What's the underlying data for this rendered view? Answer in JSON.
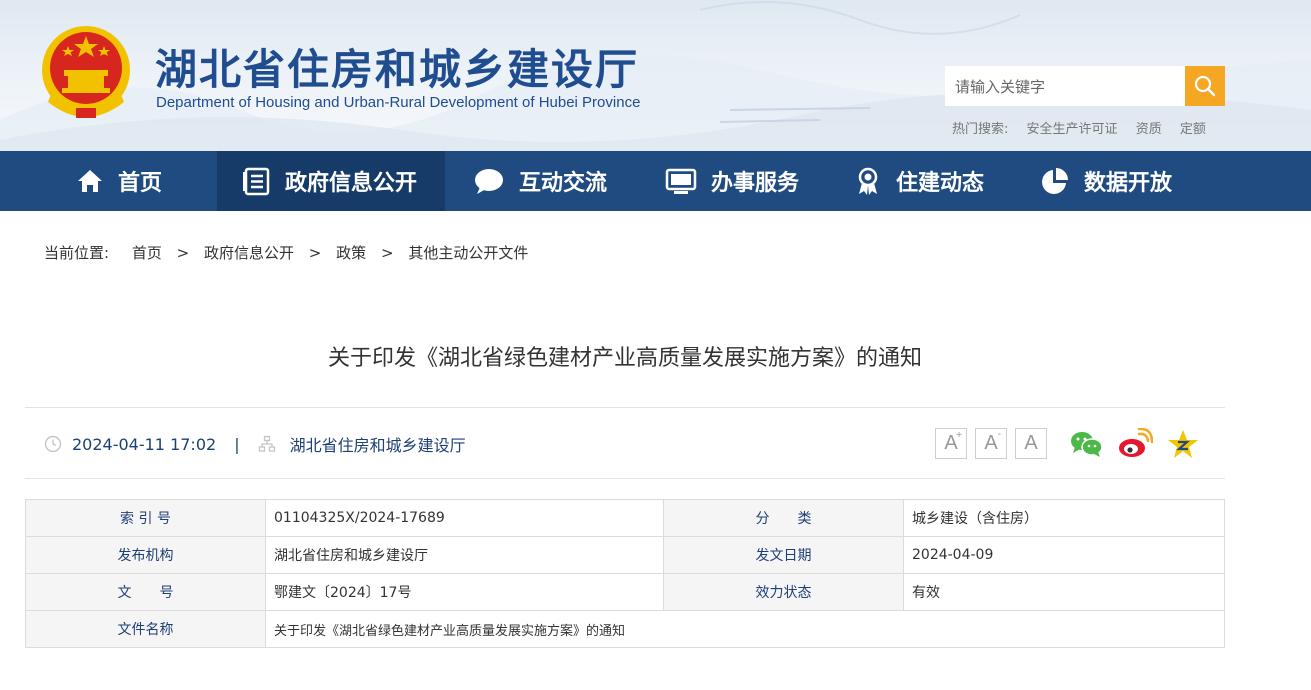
{
  "header": {
    "title": "湖北省住房和城乡建设厅",
    "subtitle": "Department of Housing and Urban-Rural Development of Hubei Province",
    "search_placeholder": "请输入关键字",
    "hot_label": "热门搜索:",
    "hot_items": [
      "安全生产许可证",
      "资质",
      "定额"
    ]
  },
  "nav": {
    "items": [
      {
        "label": "首页",
        "icon": "home-icon"
      },
      {
        "label": "政府信息公开",
        "icon": "document-list-icon"
      },
      {
        "label": "互动交流",
        "icon": "chat-bubble-icon"
      },
      {
        "label": "办事服务",
        "icon": "monitor-icon"
      },
      {
        "label": "住建动态",
        "icon": "award-icon"
      },
      {
        "label": "数据开放",
        "icon": "pie-chart-icon"
      }
    ],
    "active_index": 1
  },
  "breadcrumb": {
    "label": "当前位置:",
    "items": [
      "首页",
      "政府信息公开",
      "政策",
      "其他主动公开文件"
    ],
    "separator": ">"
  },
  "article": {
    "title": "关于印发《湖北省绿色建材产业高质量发展实施方案》的通知",
    "datetime": "2024-04-11 17:02",
    "meta_separator": "|",
    "source": "湖北省住房和城乡建设厅",
    "font_buttons": [
      "A",
      "A",
      "A"
    ],
    "share_icons": [
      "wechat-icon",
      "weibo-icon",
      "qzone-icon"
    ]
  },
  "info_table": {
    "rows": [
      {
        "l1": "索 引 号",
        "v1": "01104325X/2024-17689",
        "l2": "分　　类",
        "v2": "城乡建设（含住房）"
      },
      {
        "l1": "发布机构",
        "v1": "湖北省住房和城乡建设厅",
        "l2": "发文日期",
        "v2": "2024-04-09"
      },
      {
        "l1": "文　　号",
        "v1": "鄂建文〔2024〕17号",
        "l2": "效力状态",
        "v2": "有效"
      },
      {
        "l1": "文件名称",
        "v1": "关于印发《湖北省绿色建材产业高质量发展实施方案》的通知"
      }
    ]
  },
  "colors": {
    "nav_bg": "#1f4b80",
    "nav_active": "#163b68",
    "title_blue": "#1f4d8f",
    "search_orange": "#f5a623",
    "emblem_red": "#d7261e",
    "emblem_gold": "#f2c200"
  }
}
